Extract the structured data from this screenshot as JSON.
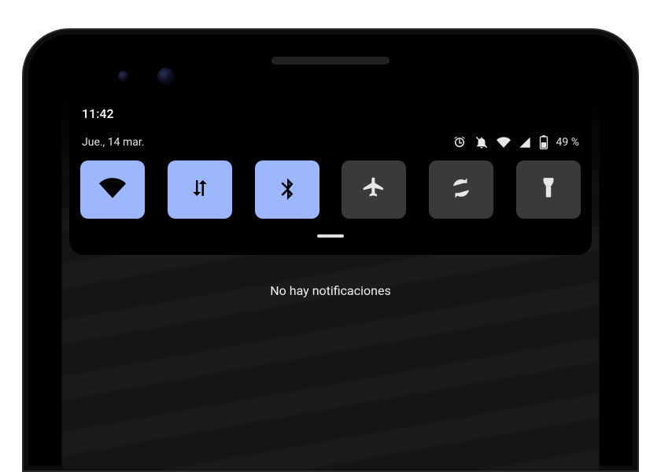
{
  "clock": "11:42",
  "date_label": "Jue., 14 mar.",
  "battery_percent_label": "49 %",
  "no_notifications_label": "No hay notificaciones",
  "status_icons": {
    "alarm": "alarm-icon",
    "dnd_off": "dnd-off-icon",
    "wifi": "wifi-icon",
    "signal": "cellular-signal-icon",
    "battery": "battery-icon"
  },
  "tiles": [
    {
      "name": "wifi-tile",
      "icon": "wifi-icon",
      "active": true
    },
    {
      "name": "mobile-data-tile",
      "icon": "data-arrows-icon",
      "active": true
    },
    {
      "name": "bluetooth-tile",
      "icon": "bluetooth-icon",
      "active": true
    },
    {
      "name": "airplane-tile",
      "icon": "airplane-icon",
      "active": false
    },
    {
      "name": "auto-rotate-tile",
      "icon": "auto-rotate-icon",
      "active": false
    },
    {
      "name": "flashlight-tile",
      "icon": "flashlight-icon",
      "active": false
    }
  ],
  "colors": {
    "tile_active_bg": "#9db7ff",
    "tile_inactive_bg": "#3a3a3a",
    "panel_bg": "#000000",
    "text": "#ffffff"
  }
}
